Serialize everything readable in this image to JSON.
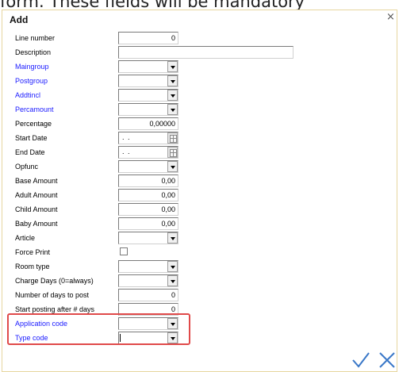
{
  "caption": {
    "prefix": "form. ",
    "underlined": "These fields will be mandatory"
  },
  "dialog": {
    "title": "Add",
    "close_glyph": "×"
  },
  "fields": {
    "line_number": {
      "label": "Line number",
      "value": "0"
    },
    "description": {
      "label": "Description",
      "value": ""
    },
    "maingroup": {
      "label": "Maingroup",
      "value": ""
    },
    "postgroup": {
      "label": "Postgroup",
      "value": ""
    },
    "addtincl": {
      "label": "Addtincl",
      "value": ""
    },
    "percamount": {
      "label": "Percamount",
      "value": ""
    },
    "percentage": {
      "label": "Percentage",
      "value": "0,00000"
    },
    "start_date": {
      "label": "Start Date",
      "value": ". ."
    },
    "end_date": {
      "label": "End Date",
      "value": ". ."
    },
    "opfunc": {
      "label": "Opfunc",
      "value": ""
    },
    "base_amount": {
      "label": "Base Amount",
      "value": "0,00"
    },
    "adult_amount": {
      "label": "Adult Amount",
      "value": "0,00"
    },
    "child_amount": {
      "label": "Child Amount",
      "value": "0,00"
    },
    "baby_amount": {
      "label": "Baby Amount",
      "value": "0,00"
    },
    "article": {
      "label": "Article",
      "value": ""
    },
    "force_print": {
      "label": "Force Print",
      "checked": false
    },
    "room_type": {
      "label": "Room type",
      "value": ""
    },
    "charge_days": {
      "label": "Charge Days (0=always)",
      "value": ""
    },
    "days_to_post": {
      "label": "Number of days to post",
      "value": "0"
    },
    "start_posting": {
      "label": "Start posting after # days",
      "value": "0"
    },
    "application_code": {
      "label": "Application code",
      "value": ""
    },
    "type_code": {
      "label": "Type code",
      "value": ""
    }
  },
  "colors": {
    "mandatory_label": "#1a1aff",
    "highlight_border": "#e04a4a",
    "action_icons": "#3a78c8"
  }
}
